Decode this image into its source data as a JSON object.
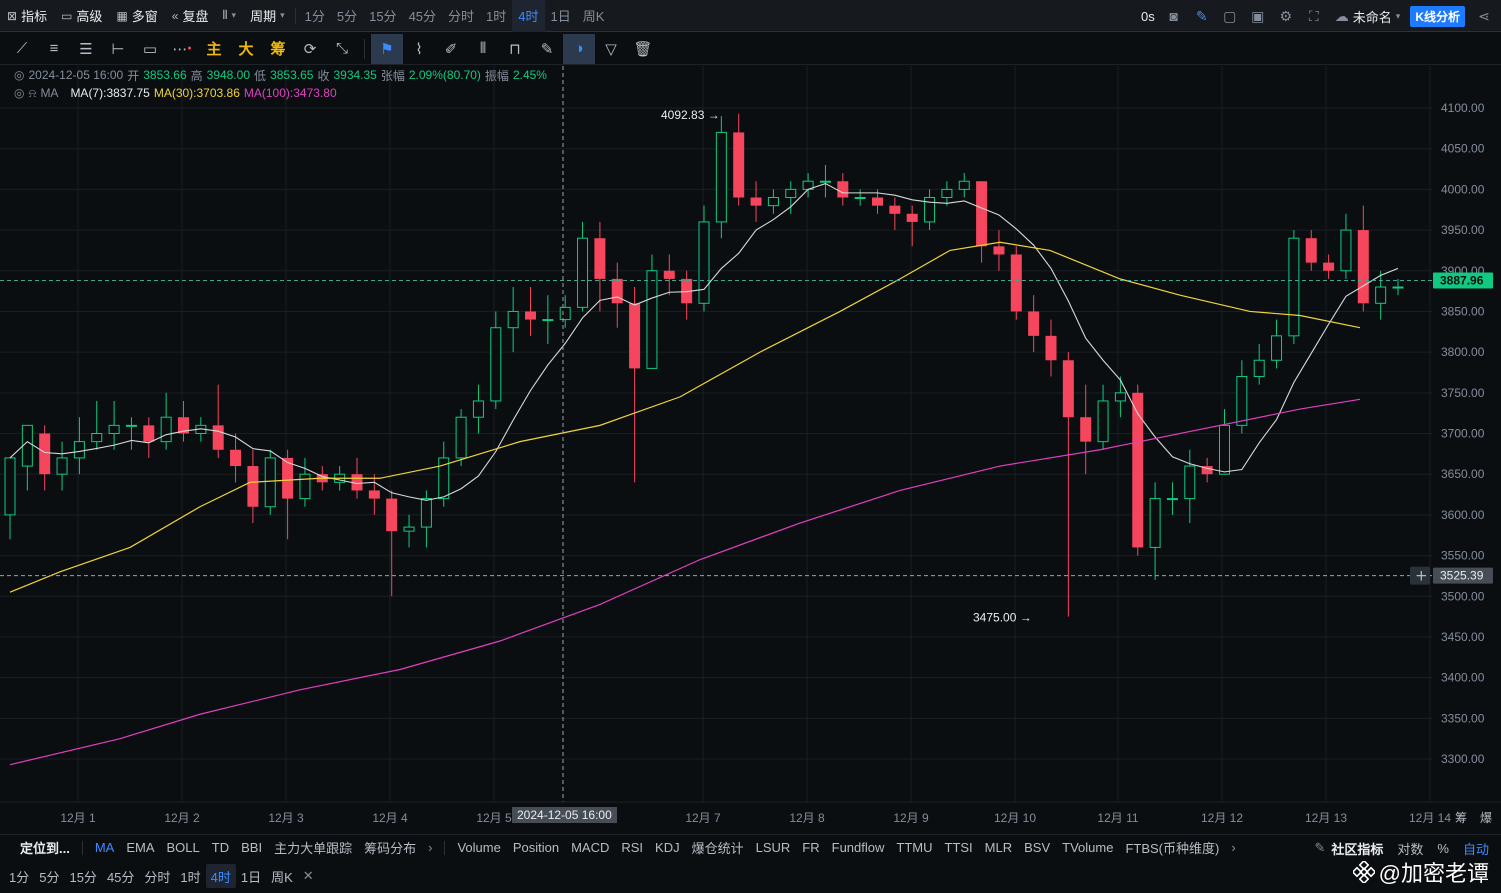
{
  "toolbar": {
    "indicators": "指标",
    "advanced": "高级",
    "multi": "多窗",
    "replay": "复盘",
    "period": "周期",
    "intervals": [
      "1分",
      "5分",
      "15分",
      "45分",
      "分时",
      "1时",
      "4时",
      "1日",
      "周K"
    ],
    "active_interval": "4时",
    "countdown": "0s",
    "layout_name": "未命名",
    "kline_analysis": "K线分析"
  },
  "drawing_tools": {
    "main": "主",
    "big": "大",
    "chips": "筹"
  },
  "legend": {
    "date": "2024-12-05 16:00",
    "open_label": "开",
    "open": "3853.66",
    "high_label": "高",
    "high": "3948.00",
    "low_label": "低",
    "low": "3853.65",
    "close_label": "收",
    "close": "3934.35",
    "change_label": "张幅",
    "change": "2.09%(80.70)",
    "amp_label": "振幅",
    "amp": "2.45%",
    "ma_name": "MA",
    "ma7": "MA(7):3837.75",
    "ma30": "MA(30):3703.86",
    "ma100": "MA(100):3473.80"
  },
  "colors": {
    "up": "#0ecb81",
    "down": "#f6465d",
    "ma7": "#d9d9d9",
    "ma30": "#f0d43a",
    "ma100": "#e040c0",
    "accent": "#1e7bff"
  },
  "chart_data": {
    "type": "candlestick",
    "title": "",
    "y_ticks": [
      3300,
      3350,
      3400,
      3450,
      3500,
      3550,
      3600,
      3650,
      3700,
      3750,
      3800,
      3850,
      3900,
      3950,
      4000,
      4050,
      4100
    ],
    "ylim": [
      3270,
      4130
    ],
    "x_tick_labels": [
      "12月 1",
      "12月 2",
      "12月 3",
      "12月 4",
      "12月 5",
      "12月 7",
      "12月 8",
      "12月 9",
      "12月 10",
      "12月 11",
      "12月 12",
      "12月 13",
      "12月 14"
    ],
    "crosshair_time": "2024-12-05 16:00",
    "price_line": {
      "value": 3887.96,
      "label": "3887.96"
    },
    "cursor_line": {
      "value": 3525.39,
      "label": "3525.39"
    },
    "high_mark": {
      "value": 4092.83,
      "label": "4092.83 →"
    },
    "low_mark": {
      "value": 3475.0,
      "label": "3475.00 →"
    },
    "candles": [
      [
        3600,
        3670,
        3570,
        3660
      ],
      [
        3660,
        3710,
        3630,
        3700
      ],
      [
        3700,
        3650,
        3630,
        3710
      ],
      [
        3650,
        3670,
        3630,
        3690
      ],
      [
        3670,
        3690,
        3650,
        3720
      ],
      [
        3690,
        3700,
        3680,
        3740
      ],
      [
        3700,
        3710,
        3680,
        3740
      ],
      [
        3710,
        3710,
        3680,
        3720
      ],
      [
        3710,
        3690,
        3670,
        3720
      ],
      [
        3690,
        3720,
        3680,
        3750
      ],
      [
        3720,
        3700,
        3690,
        3740
      ],
      [
        3700,
        3710,
        3690,
        3720
      ],
      [
        3710,
        3680,
        3670,
        3760
      ],
      [
        3680,
        3660,
        3640,
        3700
      ],
      [
        3660,
        3610,
        3590,
        3680
      ],
      [
        3610,
        3670,
        3600,
        3680
      ],
      [
        3670,
        3620,
        3570,
        3680
      ],
      [
        3620,
        3650,
        3610,
        3670
      ],
      [
        3650,
        3640,
        3630,
        3660
      ],
      [
        3640,
        3650,
        3630,
        3660
      ],
      [
        3650,
        3630,
        3620,
        3670
      ],
      [
        3630,
        3620,
        3600,
        3650
      ],
      [
        3620,
        3580,
        3500,
        3630
      ],
      [
        3580,
        3585,
        3560,
        3600
      ],
      [
        3585,
        3620,
        3560,
        3630
      ],
      [
        3620,
        3670,
        3610,
        3690
      ],
      [
        3670,
        3720,
        3660,
        3730
      ],
      [
        3720,
        3740,
        3700,
        3760
      ],
      [
        3740,
        3830,
        3730,
        3850
      ],
      [
        3830,
        3850,
        3800,
        3880
      ],
      [
        3850,
        3840,
        3820,
        3880
      ],
      [
        3840,
        3840,
        3810,
        3870
      ],
      [
        3840,
        3855,
        3830,
        3870
      ],
      [
        3855,
        3940,
        3850,
        3960
      ],
      [
        3940,
        3890,
        3850,
        3960
      ],
      [
        3890,
        3860,
        3830,
        3910
      ],
      [
        3860,
        3780,
        3640,
        3880
      ],
      [
        3780,
        3900,
        3780,
        3920
      ],
      [
        3900,
        3890,
        3870,
        3920
      ],
      [
        3890,
        3860,
        3840,
        3900
      ],
      [
        3860,
        3960,
        3850,
        3980
      ],
      [
        3960,
        4070,
        3940,
        4090
      ],
      [
        4070,
        3990,
        3980,
        4093
      ],
      [
        3990,
        3980,
        3960,
        4010
      ],
      [
        3980,
        3990,
        3970,
        4000
      ],
      [
        3990,
        4000,
        3970,
        4010
      ],
      [
        4000,
        4010,
        3990,
        4020
      ],
      [
        4010,
        4010,
        3990,
        4030
      ],
      [
        4010,
        3990,
        3980,
        4020
      ],
      [
        3990,
        3990,
        3980,
        4000
      ],
      [
        3990,
        3980,
        3970,
        4000
      ],
      [
        3980,
        3970,
        3950,
        3990
      ],
      [
        3970,
        3960,
        3930,
        3980
      ],
      [
        3960,
        3990,
        3950,
        4000
      ],
      [
        3990,
        4000,
        3980,
        4010
      ],
      [
        4000,
        4010,
        3990,
        4020
      ],
      [
        4010,
        3930,
        3910,
        4010
      ],
      [
        3930,
        3920,
        3900,
        3950
      ],
      [
        3920,
        3850,
        3840,
        3930
      ],
      [
        3850,
        3820,
        3800,
        3870
      ],
      [
        3820,
        3790,
        3770,
        3840
      ],
      [
        3790,
        3720,
        3475,
        3800
      ],
      [
        3720,
        3690,
        3650,
        3760
      ],
      [
        3690,
        3740,
        3680,
        3760
      ],
      [
        3740,
        3750,
        3720,
        3770
      ],
      [
        3750,
        3560,
        3550,
        3760
      ],
      [
        3560,
        3620,
        3520,
        3640
      ],
      [
        3620,
        3620,
        3600,
        3640
      ],
      [
        3620,
        3660,
        3590,
        3680
      ],
      [
        3660,
        3650,
        3640,
        3670
      ],
      [
        3650,
        3710,
        3650,
        3730
      ],
      [
        3710,
        3770,
        3700,
        3790
      ],
      [
        3770,
        3790,
        3760,
        3810
      ],
      [
        3790,
        3820,
        3780,
        3840
      ],
      [
        3820,
        3940,
        3810,
        3950
      ],
      [
        3940,
        3910,
        3900,
        3950
      ],
      [
        3910,
        3900,
        3890,
        3920
      ],
      [
        3900,
        3950,
        3890,
        3970
      ],
      [
        3950,
        3860,
        3850,
        3980
      ],
      [
        3860,
        3880,
        3840,
        3900
      ],
      [
        3880,
        3880,
        3870,
        3890
      ]
    ]
  },
  "time_axis_label": "2024-12-05 16:00",
  "price_axis_icon": "plus-icon",
  "indicator_bar": {
    "locate": "定位到...",
    "main_items": [
      "MA",
      "EMA",
      "BOLL",
      "TD",
      "BBI",
      "主力大单跟踪",
      "筹码分布"
    ],
    "active_main": "MA",
    "sub_items": [
      "Volume",
      "Position",
      "MACD",
      "RSI",
      "KDJ",
      "爆仓统计",
      "LSUR",
      "FR",
      "Fundflow",
      "TTMU",
      "TTSI",
      "MLR",
      "BSV",
      "TVolume",
      "FTBS(币种维度)"
    ],
    "community": "社区指标",
    "log": "对数",
    "percent": "%",
    "auto": "自动"
  },
  "bottom_intervals": [
    "1分",
    "5分",
    "15分",
    "45分",
    "分时",
    "1时",
    "4时",
    "1日",
    "周K"
  ],
  "bottom_active": "4时",
  "x_tick_extra": "筹",
  "x_tick_extra2": "爆",
  "watermark": "@加密老谭"
}
